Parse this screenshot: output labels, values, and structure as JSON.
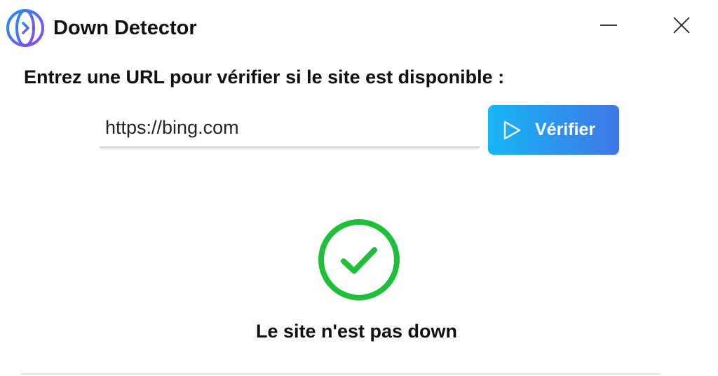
{
  "window": {
    "title": "Down Detector",
    "app_icon": "down-detector-logo-icon",
    "minimize_icon": "minimize-icon",
    "close_icon": "close-icon"
  },
  "main": {
    "prompt": "Entrez une URL pour vérifier si le site est disponible :",
    "url_input": {
      "value": "https://bing.com",
      "placeholder": ""
    },
    "verify_button": {
      "label": "Vérifier",
      "icon": "play-outline-icon"
    },
    "result": {
      "icon": "check-circle-icon",
      "message": "Le site n'est pas down"
    }
  },
  "colors": {
    "button_gradient_start": "#18b6f6",
    "button_gradient_end": "#3f76e6",
    "success": "#1fbf3a",
    "logo_purple": "#8b46e8",
    "logo_blue": "#1f8ef1"
  }
}
